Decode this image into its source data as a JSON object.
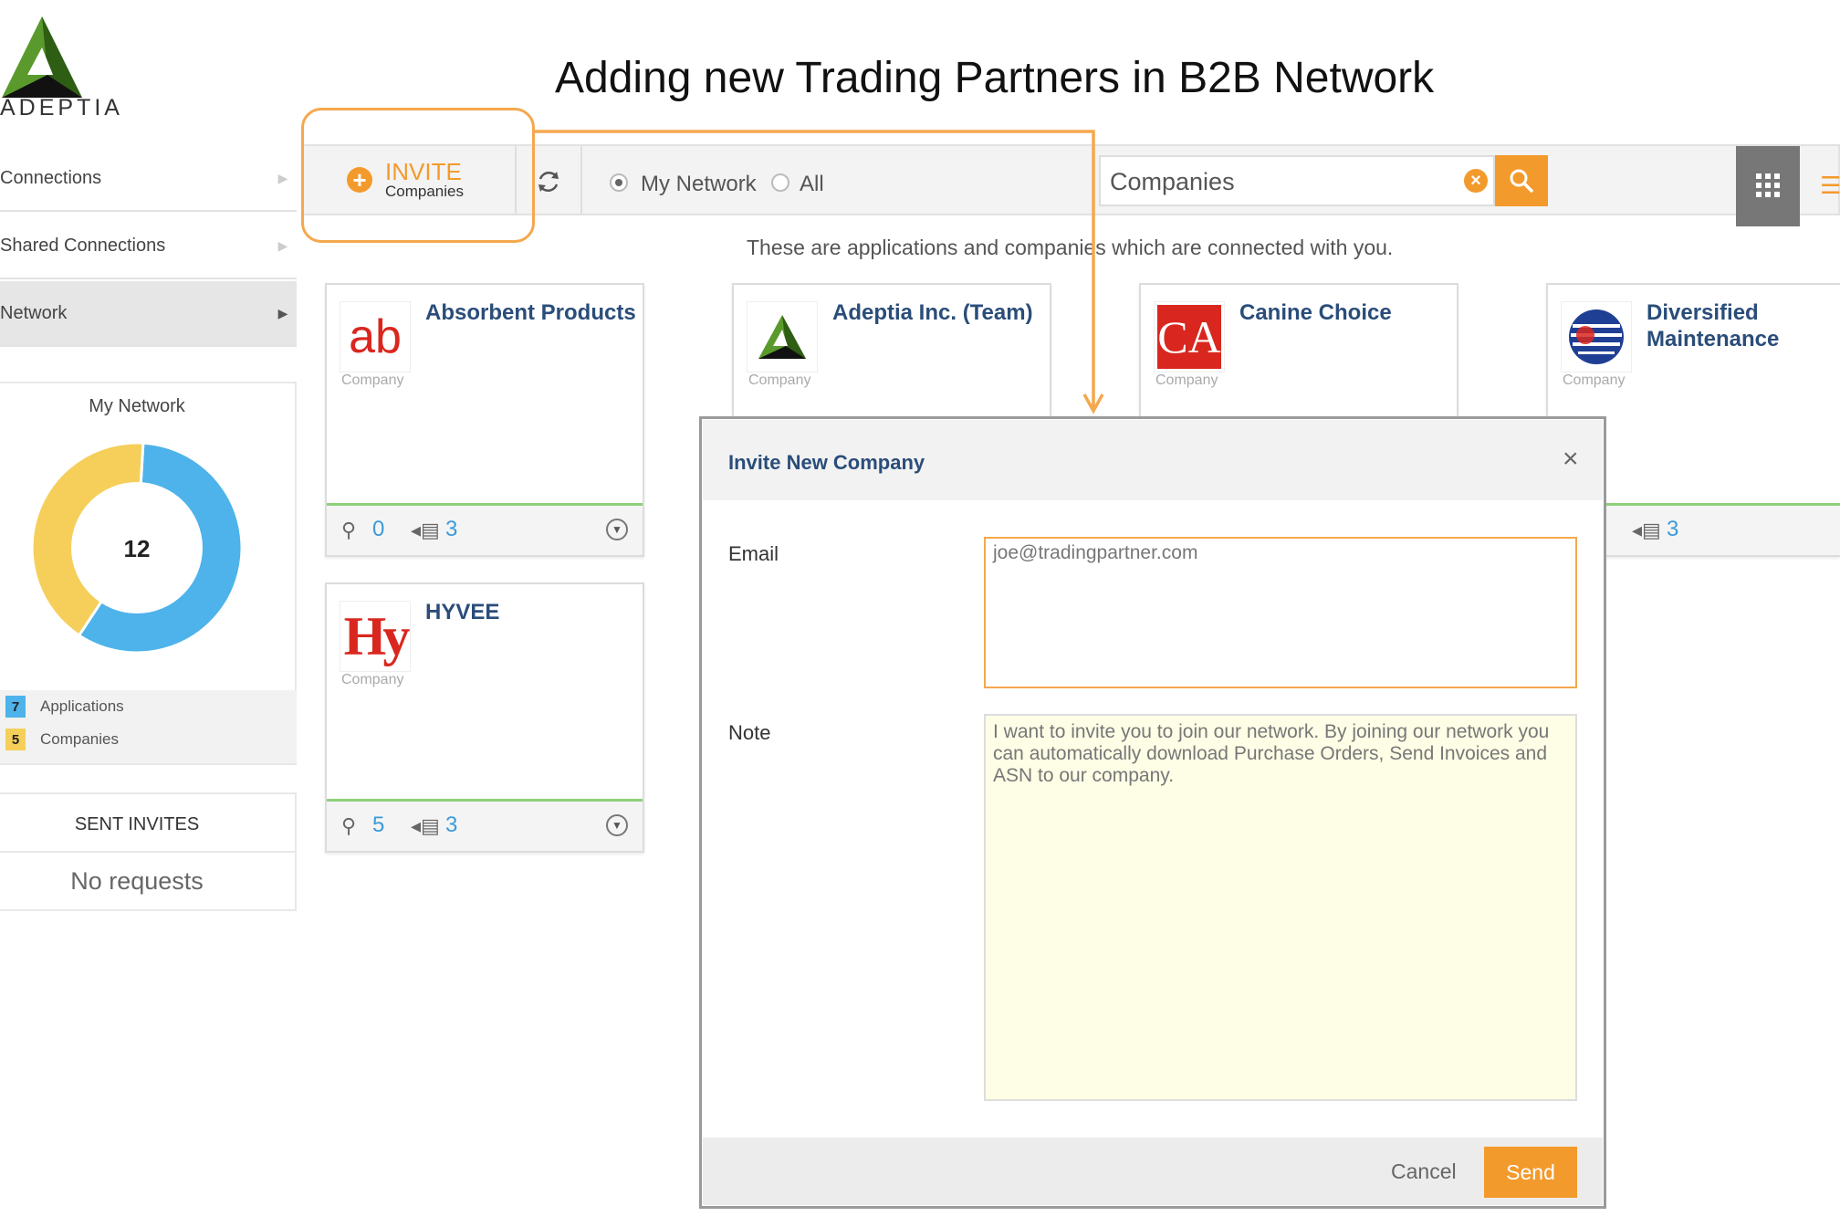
{
  "page": {
    "title": "Adding new Trading Partners in B2B Network"
  },
  "brand": {
    "name": "ADEPTIA",
    "accent": "#f39a2c",
    "link_blue": "#2a4d7a",
    "count_blue": "#3a9ad9"
  },
  "sidebar": {
    "items": [
      {
        "label": "Connections",
        "icon": "chevron-right-icon"
      },
      {
        "label": "Shared Connections",
        "icon": "chevron-right-icon"
      },
      {
        "label": "Network",
        "icon": "chevron-right-icon",
        "active": true
      }
    ],
    "my_network": {
      "title": "My Network",
      "total": "12",
      "legend": [
        {
          "count": "7",
          "label": "Applications",
          "color": "#4db3ea"
        },
        {
          "count": "5",
          "label": "Companies",
          "color": "#f5cf5a"
        }
      ]
    },
    "sent_invites": {
      "title": "SENT INVITES",
      "empty": "No requests"
    }
  },
  "chart_data": {
    "type": "pie",
    "categories": [
      "Applications",
      "Companies"
    ],
    "values": [
      7,
      5
    ],
    "colors": [
      "#4db3ea",
      "#f5cf5a"
    ],
    "center_label": "12",
    "title": "My Network"
  },
  "toolbar": {
    "invite_label": "INVITE",
    "invite_sub": "Companies",
    "filter_options": [
      {
        "label": "My Network",
        "selected": true
      },
      {
        "label": "All",
        "selected": false
      }
    ],
    "search_value": "Companies",
    "search_icon": "search-icon",
    "clear_icon": "clear-icon",
    "grid_view_icon": "grid-icon",
    "list_view_icon": "list-icon"
  },
  "subtitle": "These are applications and companies which are connected with you.",
  "cards": [
    {
      "name": "Absorbent Products",
      "logo_text": "ab",
      "type": "Company",
      "endpoints": "0",
      "connections": "3"
    },
    {
      "name": "Adeptia Inc. (Team)",
      "logo_text": "",
      "type": "Company"
    },
    {
      "name": "Canine Choice",
      "logo_text": "CA",
      "type": "Company"
    },
    {
      "name": "Diversified Maintenance",
      "logo_text": "",
      "type": "Company",
      "connections": "3"
    },
    {
      "name": "HYVEE",
      "logo_text": "Hy",
      "type": "Company",
      "endpoints": "5",
      "connections": "3"
    }
  ],
  "modal": {
    "title": "Invite New Company",
    "email_label": "Email",
    "email_value": "joe@tradingpartner.com",
    "note_label": "Note",
    "note_value": "I want to invite you to join our network. By joining our network you can automatically download Purchase Orders, Send Invoices and ASN to our company.",
    "cancel_label": "Cancel",
    "send_label": "Send"
  }
}
